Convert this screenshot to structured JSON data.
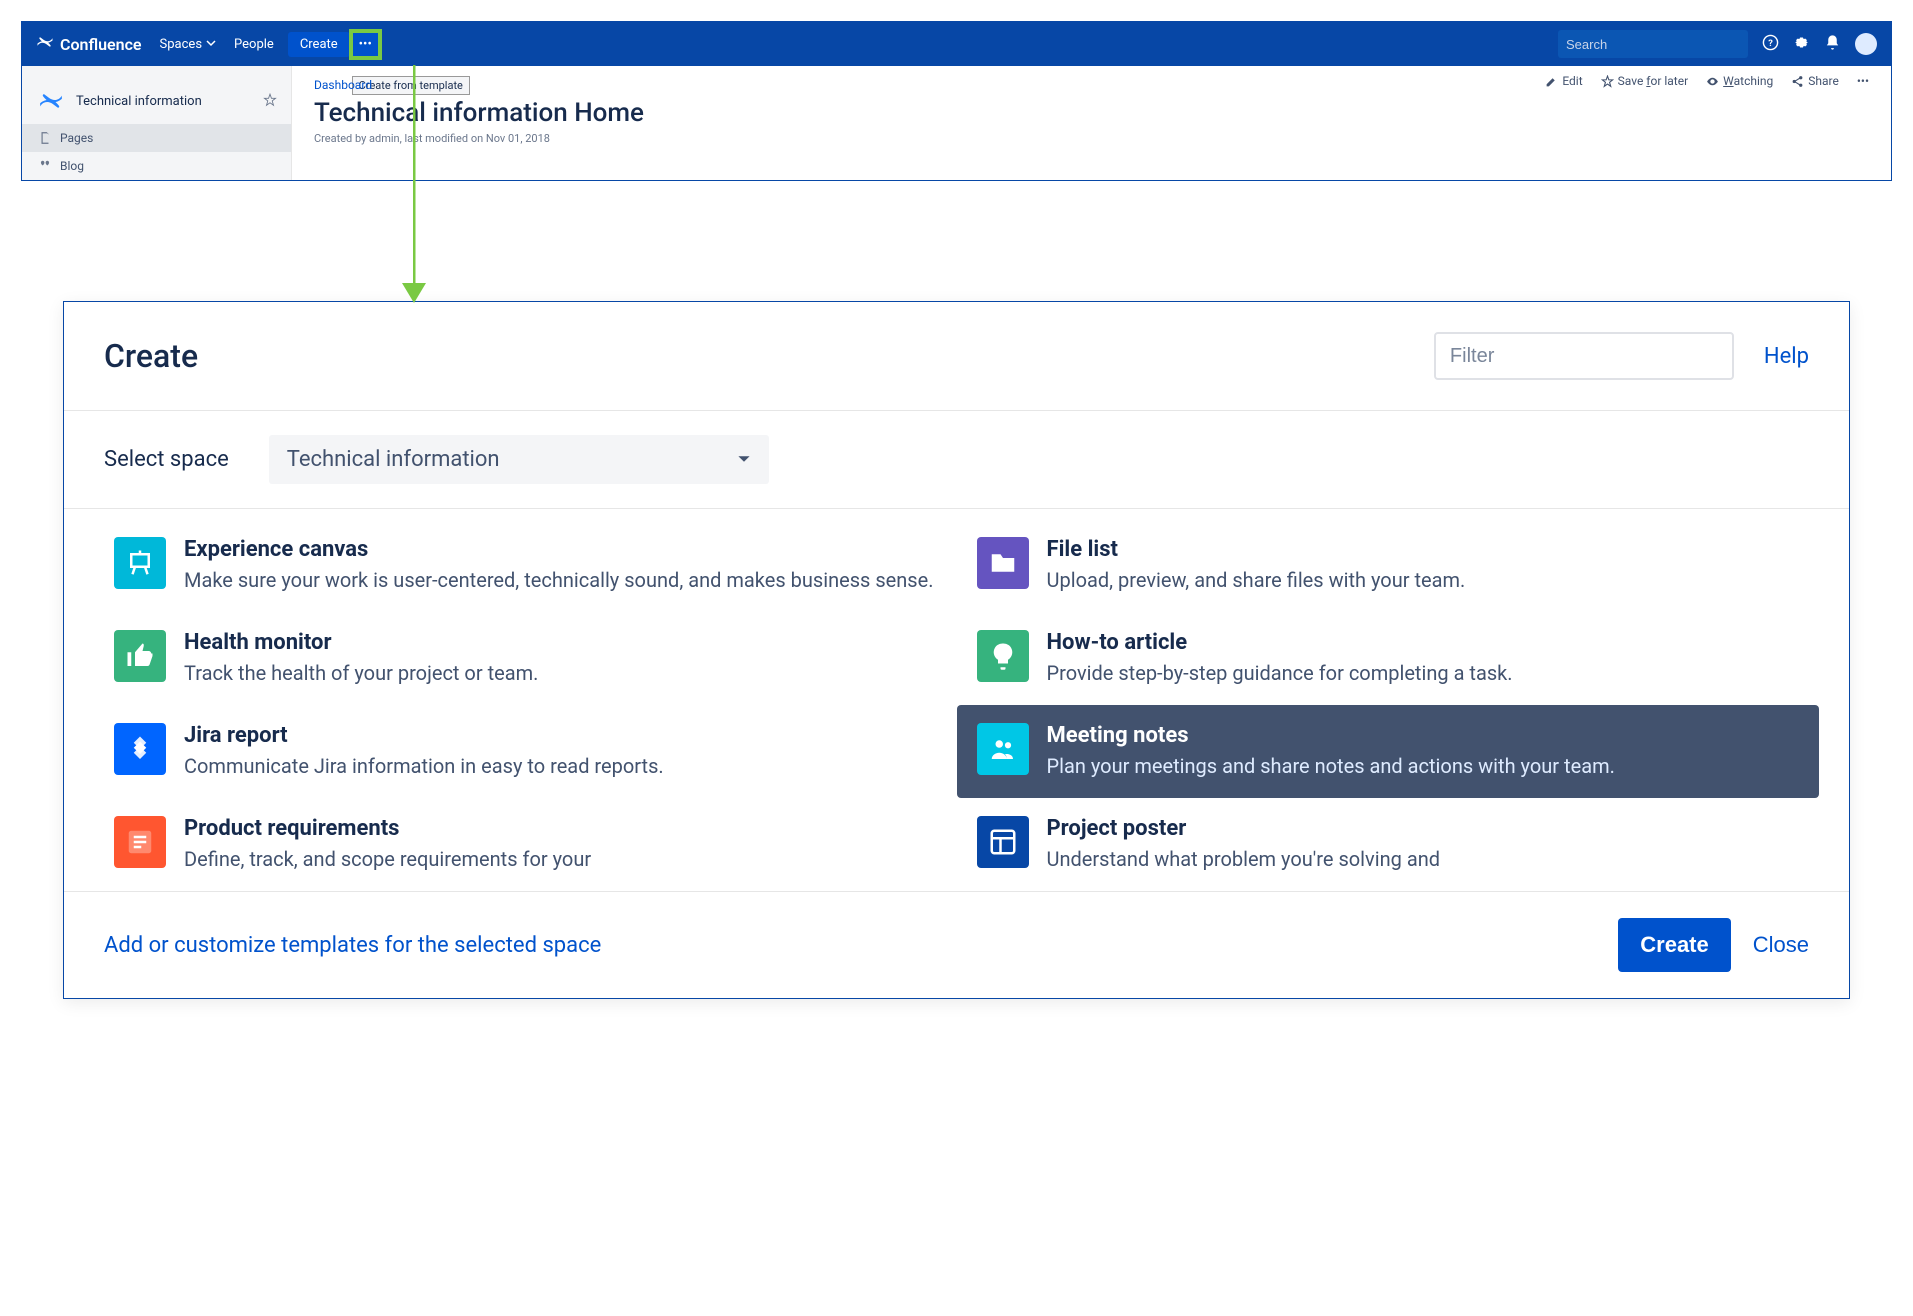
{
  "header": {
    "brand": "Confluence",
    "nav": {
      "spaces": "Spaces",
      "people": "People",
      "create": "Create"
    },
    "tooltip": "Create from template",
    "search_placeholder": "Search"
  },
  "sidebar": {
    "space_name": "Technical information",
    "items": {
      "pages": "Pages",
      "blog": "Blog"
    }
  },
  "page": {
    "breadcrumb": "Dashboard",
    "title": "Technical information Home",
    "meta": "Created by admin, last modified on Nov 01, 2018",
    "actions": {
      "edit": "Edit",
      "save": "Save for later",
      "watch": "Watching",
      "share": "Share"
    }
  },
  "dialog": {
    "title": "Create",
    "filter_placeholder": "Filter",
    "help": "Help",
    "select_space_label": "Select space",
    "selected_space": "Technical information",
    "templates": [
      {
        "id": "experience-canvas",
        "title": "Experience canvas",
        "desc": "Make sure your work is user-centered, technically sound, and makes business sense.",
        "icon": "easel",
        "color": "ic-teal"
      },
      {
        "id": "file-list",
        "title": "File list",
        "desc": "Upload, preview, and share files with your team.",
        "icon": "folder",
        "color": "ic-purple"
      },
      {
        "id": "health-monitor",
        "title": "Health monitor",
        "desc": "Track the health of your project or team.",
        "icon": "thumb",
        "color": "ic-green"
      },
      {
        "id": "howto",
        "title": "How-to article",
        "desc": "Provide step-by-step guidance for completing a task.",
        "icon": "bulb",
        "color": "ic-green"
      },
      {
        "id": "jira-report",
        "title": "Jira report",
        "desc": "Communicate Jira information in easy to read reports.",
        "icon": "jira",
        "color": "ic-blue"
      },
      {
        "id": "meeting-notes",
        "title": "Meeting notes",
        "desc": "Plan your meetings and share notes and actions with your team.",
        "icon": "people",
        "color": "ic-cyan",
        "selected": true
      },
      {
        "id": "product-req",
        "title": "Product requirements",
        "desc": "Define, track, and scope requirements for your",
        "icon": "list",
        "color": "ic-orange"
      },
      {
        "id": "project-poster",
        "title": "Project poster",
        "desc": "Understand what problem you're solving and",
        "icon": "layout",
        "color": "ic-dkblue"
      }
    ],
    "footer_link": "Add or customize templates for the selected space",
    "create_btn": "Create",
    "close_btn": "Close"
  }
}
